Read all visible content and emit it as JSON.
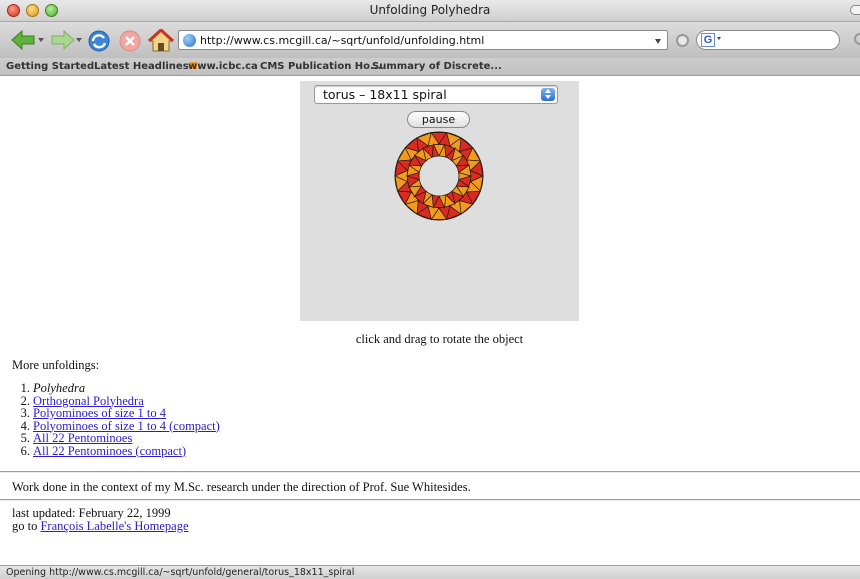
{
  "window": {
    "title": "Unfolding Polyhedra"
  },
  "toolbar": {
    "url": "http://www.cs.mcgill.ca/~sqrt/unfold/unfolding.html",
    "search_engine_letter": "G"
  },
  "bookmarks": [
    {
      "label": "Getting Started"
    },
    {
      "label": "Latest Headlines"
    },
    {
      "label": "www.icbc.ca"
    },
    {
      "label": "CMS Publication Ho..."
    },
    {
      "label": "Summary of Discrete..."
    }
  ],
  "applet": {
    "selected_option": "torus – 18x11 spiral",
    "pause_label": "pause",
    "torus_colors": {
      "fill_a": "#f39a1d",
      "fill_b": "#d92b22",
      "edge": "#2a1a10"
    }
  },
  "caption": "click and drag to rotate the object",
  "more_heading": "More unfoldings:",
  "unfoldings": [
    {
      "num": "1.",
      "label": "Polyhedra"
    },
    {
      "num": "2.",
      "label": "Orthogonal Polyhedra"
    },
    {
      "num": "3.",
      "label": "Polyominoes of size 1 to 4"
    },
    {
      "num": "4.",
      "label": "Polyominoes of size 1 to 4 (compact)"
    },
    {
      "num": "5.",
      "label": "All 22 Pentominoes"
    },
    {
      "num": "6.",
      "label": "All 22 Pentominoes (compact)"
    }
  ],
  "work_note": "Work done in the context of my M.Sc. research under the direction of Prof. Sue Whitesides.",
  "last_updated": "last updated: February 22, 1999",
  "goto_prefix": "go to ",
  "homepage_link": "François Labelle's Homepage",
  "status": "Opening http://www.cs.mcgill.ca/~sqrt/unfold/general/torus_18x11_spiral"
}
